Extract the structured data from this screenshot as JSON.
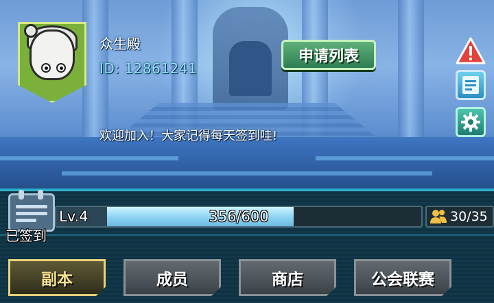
{
  "guild": {
    "name": "众生殿",
    "id_text": "ID: 12861241",
    "announcement": "欢迎加入！大家记得每天签到哇!"
  },
  "buttons": {
    "apply_list": "申请列表"
  },
  "side_icons": [
    "warning-icon",
    "notes-icon",
    "gear-icon"
  ],
  "checkin": {
    "label": "已签到"
  },
  "level": {
    "label": "Lv.4",
    "progress_text": "356/600",
    "current": 356,
    "max": 600
  },
  "members": {
    "count_text": "30/35"
  },
  "tabs": [
    {
      "label": "副本",
      "active": true
    },
    {
      "label": "成员",
      "active": false
    },
    {
      "label": "商店",
      "active": false
    },
    {
      "label": "公会联赛",
      "active": false
    }
  ],
  "colors": {
    "accent": "#2ab0c7",
    "apply_button": "#3e9863",
    "active_tab": "#e9d27a",
    "id_text": "#8fe3ff"
  }
}
